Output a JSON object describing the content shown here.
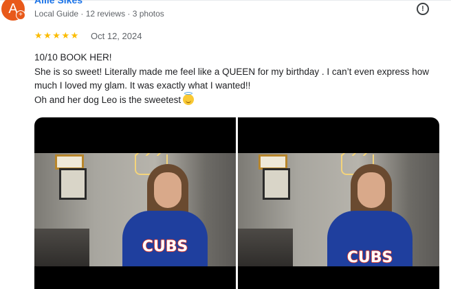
{
  "reviewer": {
    "avatar_letter": "A",
    "avatar_badge": "+",
    "name": "Allie Sikes",
    "meta": "Local Guide · 12 reviews · 3 photos"
  },
  "review": {
    "rating": 5,
    "stars": "★★★★★",
    "date": "Oct 12, 2024",
    "lines": [
      "10/10 BOOK HER!",
      "She is so sweet! Literally made me feel like a QUEEN for my birthday . I can’t even express how much I loved my glam. It was exactly what I wanted!!",
      "Oh and her dog Leo is the sweetest"
    ],
    "emoji": "smiling-face-with-halo"
  },
  "report_icon": "report-exclamation-icon",
  "photos": [
    {
      "shirt_text": "CUBS"
    },
    {
      "shirt_text": "CUBS"
    }
  ],
  "colors": {
    "name_link": "#1a73e8",
    "star": "#fbbc04",
    "avatar": "#e8591a",
    "meta_text": "#5f6368"
  }
}
